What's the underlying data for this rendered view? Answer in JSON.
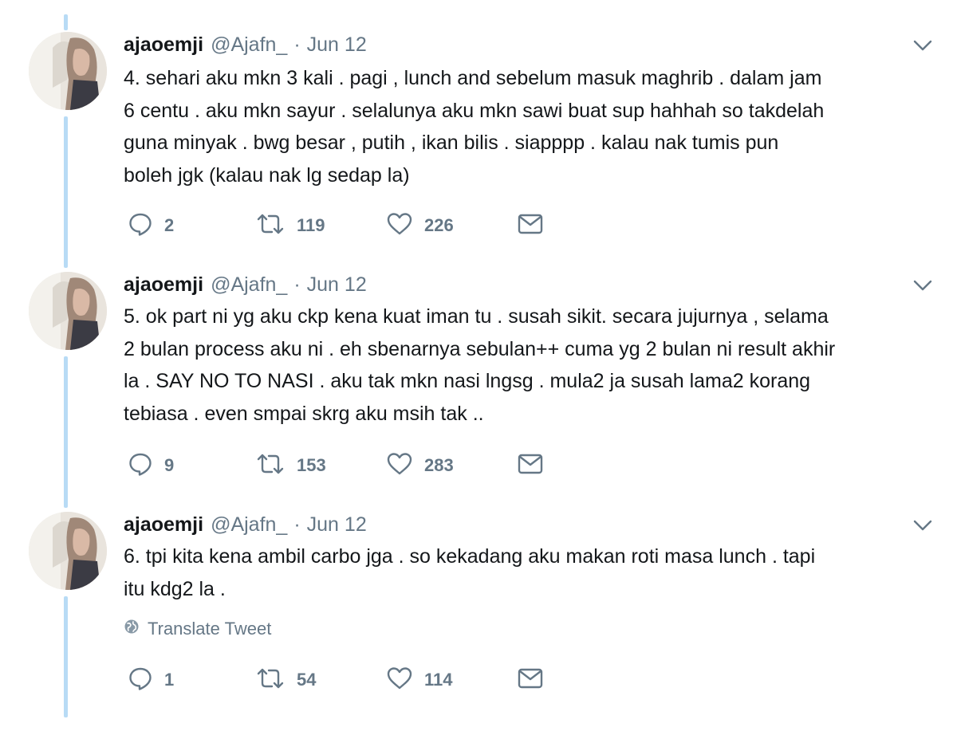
{
  "tweets": [
    {
      "name": "ajaoemji",
      "handle": "@Ajafn_",
      "separator": "·",
      "date": "Jun 12",
      "lines": [
        "4. sehari aku mkn 3 kali . pagi , lunch and sebelum masuk maghrib . dalam jam",
        "6 centu . aku mkn sayur . selalunya aku mkn sawi buat sup hahhah so takdelah",
        "guna minyak . bwg besar , putih , ikan bilis . siapppp . kalau nak tumis pun",
        "boleh jgk (kalau nak lg sedap la)"
      ],
      "replies": "2",
      "retweets": "119",
      "likes": "226"
    },
    {
      "name": "ajaoemji",
      "handle": "@Ajafn_",
      "separator": "·",
      "date": "Jun 12",
      "lines": [
        "5. ok part ni yg aku ckp kena kuat iman tu . susah sikit. secara jujurnya , selama",
        "2 bulan process aku ni . eh sbenarnya sebulan++ cuma yg 2 bulan ni result akhir",
        "la . SAY NO TO NASI . aku tak mkn nasi lngsg . mula2 ja susah lama2 korang",
        "tebiasa . even smpai skrg aku msih tak .."
      ],
      "replies": "9",
      "retweets": "153",
      "likes": "283"
    },
    {
      "name": "ajaoemji",
      "handle": "@Ajafn_",
      "separator": "·",
      "date": "Jun 12",
      "lines": [
        "6. tpi kita kena ambil carbo jga . so kekadang aku makan roti masa lunch . tapi",
        "itu kdg2 la ."
      ],
      "translate_label": "Translate Tweet",
      "replies": "1",
      "retweets": "54",
      "likes": "114"
    }
  ],
  "icons": {
    "reply": "reply-icon",
    "retweet": "retweet-icon",
    "like": "heart-icon",
    "dm": "envelope-icon",
    "caret": "chevron-down-icon",
    "globe": "globe-icon"
  },
  "colors": {
    "thread_line": "#b8dbf5",
    "secondary_text": "#657786",
    "primary_text": "#14171a"
  }
}
